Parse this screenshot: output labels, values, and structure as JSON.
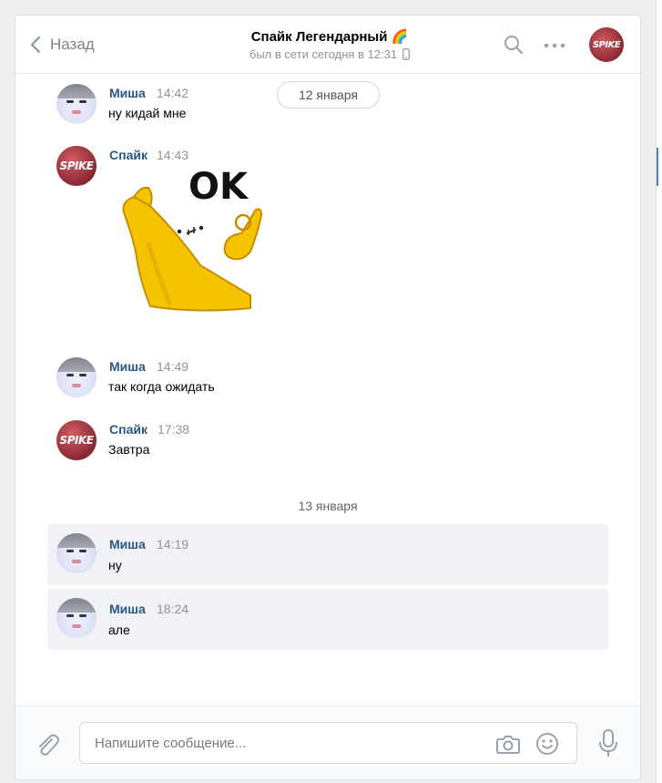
{
  "header": {
    "back_label": "Назад",
    "title": "Спайк Легендарный",
    "title_emoji": "🌈",
    "status": "был в сети сегодня в 12:31",
    "avatar_text": "SPIKE"
  },
  "dates": {
    "first": "12 января",
    "second": "13 января"
  },
  "messages": [
    {
      "author": "Миша",
      "time": "14:42",
      "text": "ну кидай мне"
    },
    {
      "author": "Спайк",
      "time": "14:43",
      "text": ""
    },
    {
      "author": "Миша",
      "time": "14:49",
      "text": "так когда ожидать"
    },
    {
      "author": "Спайк",
      "time": "17:38",
      "text": "Завтра"
    },
    {
      "author": "Миша",
      "time": "14:19",
      "text": "ну"
    },
    {
      "author": "Миша",
      "time": "18:24",
      "text": "але"
    }
  ],
  "avatar_spike_text": "SPIKE",
  "sticker": {
    "caption": "OK"
  },
  "composer": {
    "placeholder": "Напишите сообщение..."
  },
  "icons": {
    "back": "chevron-left-icon",
    "search": "search-icon",
    "more": "more-icon",
    "phone": "mobile-icon",
    "attach": "paperclip-icon",
    "camera": "camera-icon",
    "emoji": "smile-icon",
    "mic": "microphone-icon"
  },
  "colors": {
    "author_link": "#2a5885",
    "highlight_bg": "#f0f2f5",
    "page_bg": "#edeef0"
  }
}
